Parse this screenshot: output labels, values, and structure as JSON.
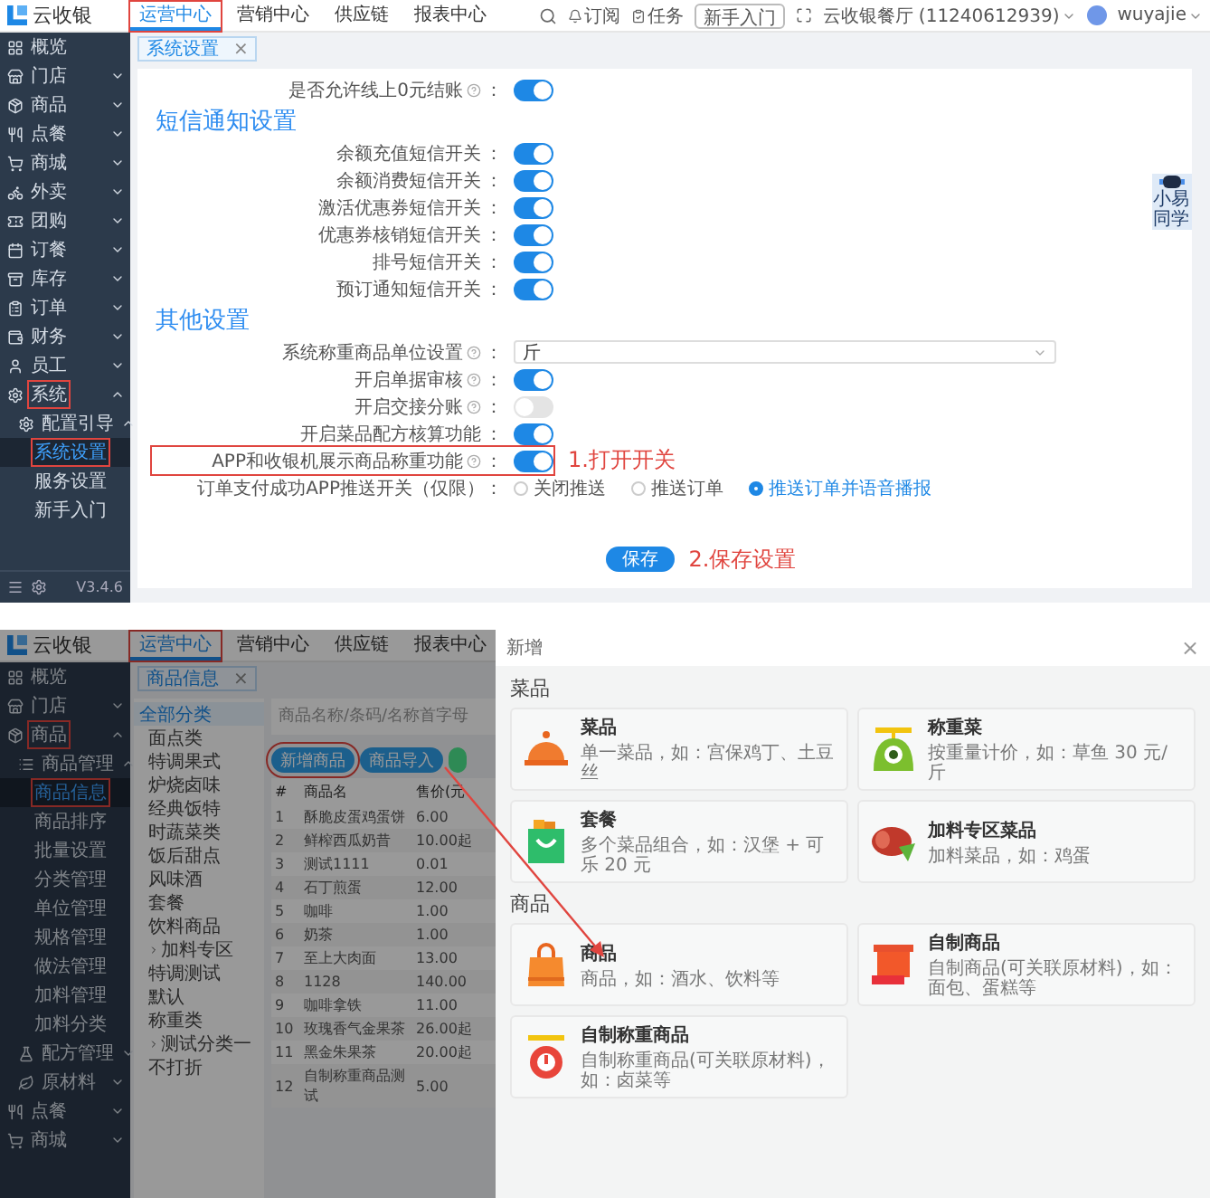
{
  "top": {
    "header": {
      "logo": "云收银",
      "tabs": [
        {
          "label": "运营中心",
          "selected": true,
          "marked": true
        },
        {
          "label": "营销中心",
          "selected": false,
          "marked": false
        },
        {
          "label": "供应链",
          "selected": false,
          "marked": false
        },
        {
          "label": "报表中心",
          "selected": false,
          "marked": false
        }
      ],
      "subscribe": "订阅",
      "tasks": "任务",
      "guide_button": "新手入门",
      "store": "云收银餐厅 (11240612939)",
      "user": "wuyajie"
    },
    "open_tab": {
      "label": "系统设置",
      "close": "×"
    },
    "sidebar": {
      "items": [
        {
          "label": "概览",
          "selected": false,
          "marked": false
        },
        {
          "label": "门店",
          "expanded": false,
          "selected": false,
          "marked": false
        },
        {
          "label": "商品",
          "expanded": false,
          "selected": false,
          "marked": false
        },
        {
          "label": "点餐",
          "expanded": false,
          "selected": false,
          "marked": false
        },
        {
          "label": "商城",
          "expanded": false,
          "selected": false,
          "marked": false
        },
        {
          "label": "外卖",
          "expanded": false,
          "selected": false,
          "marked": false
        },
        {
          "label": "团购",
          "expanded": false,
          "selected": false,
          "marked": false
        },
        {
          "label": "订餐",
          "expanded": false,
          "selected": false,
          "marked": false
        },
        {
          "label": "库存",
          "expanded": false,
          "selected": false,
          "marked": false
        },
        {
          "label": "订单",
          "expanded": false,
          "selected": false,
          "marked": false
        },
        {
          "label": "财务",
          "expanded": false,
          "selected": false,
          "marked": false
        },
        {
          "label": "员工",
          "expanded": false,
          "selected": false,
          "marked": false
        },
        {
          "label": "系统",
          "expanded": true,
          "selected": false,
          "marked": true,
          "children": [
            {
              "label": "配置引导",
              "expanded": true,
              "selected": false,
              "marked": false,
              "children": [
                {
                  "label": "系统设置",
                  "selected": true,
                  "marked": true
                },
                {
                  "label": "服务设置",
                  "selected": false,
                  "marked": false
                },
                {
                  "label": "新手入门",
                  "selected": false,
                  "marked": false
                }
              ]
            }
          ]
        }
      ],
      "version": "V3.4.6"
    },
    "settings": [
      {
        "kind": "toggle",
        "label": "是否允许线上0元结账",
        "help": true,
        "colon": "：",
        "on": true
      },
      {
        "kind": "heading",
        "label": "短信通知设置"
      },
      {
        "kind": "toggle",
        "label": "余额充值短信开关",
        "help": false,
        "colon": "：",
        "on": true
      },
      {
        "kind": "toggle",
        "label": "余额消费短信开关",
        "help": false,
        "colon": "：",
        "on": true
      },
      {
        "kind": "toggle",
        "label": "激活优惠券短信开关",
        "help": false,
        "colon": "：",
        "on": true
      },
      {
        "kind": "toggle",
        "label": "优惠券核销短信开关",
        "help": false,
        "colon": "：",
        "on": true
      },
      {
        "kind": "toggle",
        "label": "排号短信开关",
        "help": false,
        "colon": "：",
        "on": true
      },
      {
        "kind": "toggle",
        "label": "预订通知短信开关",
        "help": false,
        "colon": "：",
        "on": true
      },
      {
        "kind": "heading",
        "label": "其他设置"
      },
      {
        "kind": "select",
        "label": "系统称重商品单位设置",
        "help": true,
        "colon": "：",
        "value": "斤"
      },
      {
        "kind": "toggle",
        "label": "开启单据审核",
        "help": true,
        "colon": "：",
        "on": true
      },
      {
        "kind": "toggle",
        "label": "开启交接分账",
        "help": true,
        "colon": "：",
        "on": false
      },
      {
        "kind": "toggle",
        "label": "开启菜品配方核算功能",
        "help": false,
        "colon": "：",
        "on": true
      },
      {
        "kind": "toggle",
        "label": "APP和收银机展示商品称重功能",
        "help": true,
        "colon": "：",
        "on": true,
        "marked": true,
        "note": "1.打开开关"
      },
      {
        "kind": "radio",
        "label": "订单支付成功APP推送开关（仅限）：",
        "options": [
          {
            "label": "关闭推送",
            "selected": false
          },
          {
            "label": "推送订单",
            "selected": false
          },
          {
            "label": "推送订单并语音播报",
            "selected": true
          }
        ]
      }
    ],
    "save": {
      "label": "保存",
      "note": "2.保存设置"
    },
    "assistant": "小易同学"
  },
  "bottom": {
    "header": {
      "logo": "云收银",
      "tabs": [
        {
          "label": "运营中心",
          "selected": true,
          "marked": true
        },
        {
          "label": "营销中心",
          "selected": false,
          "marked": false
        },
        {
          "label": "供应链",
          "selected": false,
          "marked": false
        },
        {
          "label": "报表中心",
          "selected": false,
          "marked": false
        }
      ]
    },
    "open_tab": {
      "label": "商品信息",
      "close": "×"
    },
    "sidebar": {
      "items": [
        {
          "label": "概览",
          "selected": false,
          "marked": false
        },
        {
          "label": "门店",
          "expanded": false,
          "selected": false,
          "marked": false
        },
        {
          "label": "商品",
          "expanded": true,
          "selected": false,
          "marked": true,
          "children": [
            {
              "label": "商品管理",
              "expanded": true,
              "selected": false,
              "marked": false,
              "children": [
                {
                  "label": "商品信息",
                  "selected": true,
                  "marked": true
                },
                {
                  "label": "商品排序",
                  "selected": false,
                  "marked": false
                },
                {
                  "label": "批量设置",
                  "selected": false,
                  "marked": false
                },
                {
                  "label": "分类管理",
                  "selected": false,
                  "marked": false
                },
                {
                  "label": "单位管理",
                  "selected": false,
                  "marked": false
                },
                {
                  "label": "规格管理",
                  "selected": false,
                  "marked": false
                },
                {
                  "label": "做法管理",
                  "selected": false,
                  "marked": false
                },
                {
                  "label": "加料管理",
                  "selected": false,
                  "marked": false
                },
                {
                  "label": "加料分类",
                  "selected": false,
                  "marked": false
                }
              ]
            },
            {
              "label": "配方管理",
              "expanded": false,
              "selected": false,
              "marked": false
            },
            {
              "label": "原材料",
              "expanded": false,
              "selected": false,
              "marked": false
            }
          ]
        },
        {
          "label": "点餐",
          "expanded": false,
          "selected": false,
          "marked": false
        },
        {
          "label": "商城",
          "expanded": false,
          "selected": false,
          "marked": false
        }
      ]
    },
    "categories": [
      {
        "label": "全部分类",
        "selected": true
      },
      {
        "label": "面点类",
        "selected": false
      },
      {
        "label": "特调果式",
        "selected": false
      },
      {
        "label": "炉烧卤味",
        "selected": false
      },
      {
        "label": "经典饭特",
        "selected": false
      },
      {
        "label": "时蔬菜类",
        "selected": false
      },
      {
        "label": "饭后甜点",
        "selected": false
      },
      {
        "label": "风味酒",
        "selected": false
      },
      {
        "label": "套餐",
        "selected": false
      },
      {
        "label": "饮料商品",
        "selected": false
      },
      {
        "label": "加料专区",
        "selected": false,
        "expanded": false
      },
      {
        "label": "特调测试",
        "selected": false
      },
      {
        "label": "默认",
        "selected": false
      },
      {
        "label": "称重类",
        "selected": false
      },
      {
        "label": "测试分类一",
        "selected": false,
        "expanded": false
      },
      {
        "label": "不打折",
        "selected": false
      }
    ],
    "search": {
      "placeholder": "商品名称/条码/名称首字母"
    },
    "buttons": [
      {
        "label": "新增商品",
        "marked": true,
        "color": "#1d5f8c"
      },
      {
        "label": "商品导入",
        "marked": false,
        "color": "#1d5f8c"
      },
      {
        "marked": false,
        "color": "#2f8a55"
      }
    ],
    "table": {
      "columns": [
        "#",
        "商品名",
        "售价(元"
      ],
      "rows": [
        [
          "1",
          "酥脆皮蛋鸡蛋饼",
          "6.00"
        ],
        [
          "2",
          "鲜榨西瓜奶昔",
          "10.00起"
        ],
        [
          "3",
          "测试1111",
          "0.01"
        ],
        [
          "4",
          "石丁煎蛋",
          "12.00"
        ],
        [
          "5",
          "咖啡",
          "1.00"
        ],
        [
          "6",
          "奶茶",
          "1.00"
        ],
        [
          "7",
          "至上大肉面",
          "13.00"
        ],
        [
          "8",
          "1128",
          "140.00"
        ],
        [
          "9",
          "咖啡拿铁",
          "11.00"
        ],
        [
          "10",
          "玫瑰香气金果茶",
          "26.00起"
        ],
        [
          "11",
          "黑金朱果茶",
          "20.00起"
        ],
        [
          "12",
          "自制称重商品测试",
          "5.00"
        ]
      ]
    },
    "modal": {
      "title": "新增",
      "close": "×",
      "sections": [
        {
          "title": "菜品",
          "items": [
            {
              "title": "菜品",
              "desc": "单一菜品，如：宫保鸡丁、土豆丝"
            },
            {
              "title": "称重菜",
              "desc": "按重量计价，如：草鱼 30 元/斤"
            },
            {
              "title": "套餐",
              "desc": "多个菜品组合，如：汉堡 + 可乐 20 元"
            },
            {
              "title": "加料专区菜品",
              "desc": "加料菜品，如：鸡蛋"
            }
          ]
        },
        {
          "title": "商品",
          "items": [
            {
              "title": "商品",
              "desc": "商品，如：酒水、饮料等"
            },
            {
              "title": "自制商品",
              "desc": "自制商品(可关联原材料)，如：面包、蛋糕等"
            },
            {
              "title": "自制称重商品",
              "desc": "自制称重商品(可关联原材料)，如：卤菜等"
            }
          ]
        }
      ]
    }
  }
}
